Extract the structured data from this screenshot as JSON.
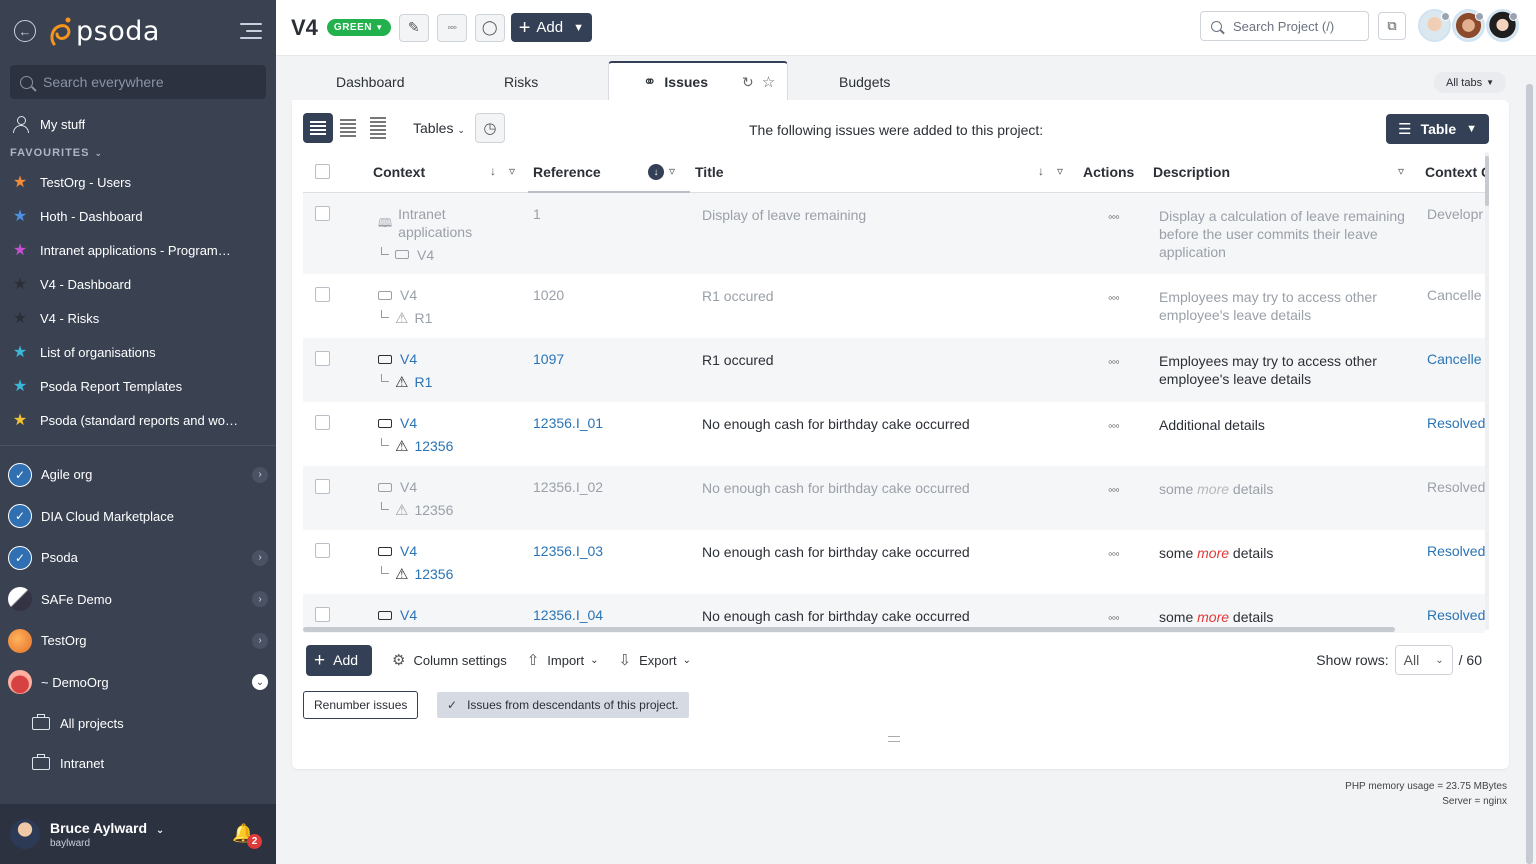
{
  "sidebar": {
    "brand": "psoda",
    "search_placeholder": "Search everywhere",
    "my_stuff": "My stuff",
    "favourites_label": "FAVOURITES",
    "favourites": [
      {
        "label": "TestOrg - Users",
        "color": "#f28c3a"
      },
      {
        "label": "Hoth - Dashboard",
        "color": "#4a8fe0"
      },
      {
        "label": "Intranet applications - Programme...",
        "color": "#c64fd0"
      },
      {
        "label": "V4 - Dashboard",
        "color": "#2b2f36"
      },
      {
        "label": "V4 - Risks",
        "color": "#2b2f36"
      },
      {
        "label": "List of organisations",
        "color": "#3bb8d8"
      },
      {
        "label": "Psoda Report Templates",
        "color": "#3bb8d8"
      },
      {
        "label": "Psoda (standard reports and work...",
        "color": "#f2c230"
      }
    ],
    "orgs": [
      {
        "label": "Agile org",
        "expandable": true
      },
      {
        "label": "DIA Cloud Marketplace",
        "expandable": false
      },
      {
        "label": "Psoda",
        "expandable": true
      },
      {
        "label": "SAFe Demo",
        "expandable": true
      },
      {
        "label": "TestOrg",
        "expandable": true
      },
      {
        "label": "~ DemoOrg",
        "expandable": true,
        "open": true
      }
    ],
    "sub_items": [
      "All projects",
      "Intranet"
    ],
    "user": {
      "name": "Bruce Aylward",
      "login": "baylward",
      "notifications": "2"
    }
  },
  "header": {
    "project_title": "V4",
    "status": "GREEN",
    "add_label": "Add",
    "search_placeholder": "Search Project (/)"
  },
  "tabs": {
    "items": [
      "Dashboard",
      "Risks",
      "Issues",
      "Budgets"
    ],
    "active": "Issues",
    "all_tabs": "All tabs"
  },
  "toolbar": {
    "tables_label": "Tables",
    "intro": "The following issues were added to this project:",
    "view_label": "Table"
  },
  "table": {
    "columns": [
      "Context",
      "Reference",
      "Title",
      "Actions",
      "Description",
      "Context C"
    ],
    "rows": [
      {
        "dim": true,
        "ctx_parent": "Intranet applications",
        "ctx_child": "V4",
        "ref": "1",
        "title": "Display of leave remaining",
        "desc": "Display a calculation of leave remaining before the user commits their leave application",
        "status": "Developr"
      },
      {
        "dim": true,
        "ctx_parent": "V4",
        "ctx_child": "R1",
        "ref": "1020",
        "title": "R1 occured",
        "desc": "Employees may try to access other employee's leave details",
        "status": "Cancelle"
      },
      {
        "dim": false,
        "ctx_parent": "V4",
        "ctx_child": "R1",
        "ref": "1097",
        "title": "R1 occured",
        "desc": "Employees may try to access other employee's leave details",
        "status": "Cancelle"
      },
      {
        "dim": false,
        "ctx_parent": "V4",
        "ctx_child": "12356",
        "ref": "12356.I_01",
        "title": "No enough cash for birthday cake occurred",
        "desc": "Additional details",
        "status": "Resolved"
      },
      {
        "dim": true,
        "ctx_parent": "V4",
        "ctx_child": "12356",
        "ref": "12356.I_02",
        "title": "No enough cash for birthday cake occurred",
        "desc_pre": "some",
        "desc_em": "more",
        "desc_post": "details",
        "status": "Resolved"
      },
      {
        "dim": false,
        "ctx_parent": "V4",
        "ctx_child": "12356",
        "ref": "12356.I_03",
        "title": "No enough cash for birthday cake occurred",
        "desc_pre": "some",
        "desc_em": "more",
        "desc_post": "details",
        "status": "Resolved"
      },
      {
        "dim": false,
        "ctx_parent": "V4",
        "ctx_child": "",
        "ref": "12356.I_04",
        "title": "No enough cash for birthday cake occurred",
        "desc_pre": "some",
        "desc_em": "more",
        "desc_post": "details",
        "status": "Resolved"
      }
    ]
  },
  "footer": {
    "add_label": "Add",
    "column_settings": "Column settings",
    "import_label": "Import",
    "export_label": "Export",
    "show_rows_label": "Show rows:",
    "show_rows_value": "All",
    "rows_total": "/ 60",
    "renumber_label": "Renumber issues",
    "descendants_label": "Issues from descendants of this project."
  },
  "server_info": {
    "memory": "PHP memory usage = 23.75 MBytes",
    "server": "Server = nginx"
  }
}
